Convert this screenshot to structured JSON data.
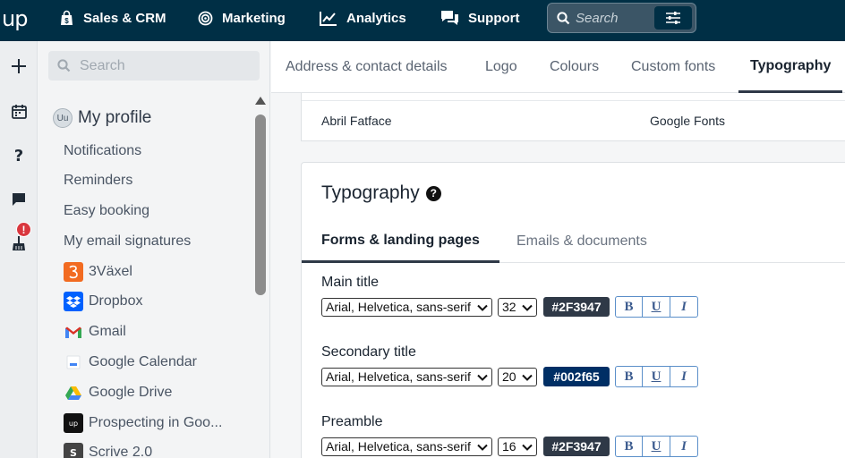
{
  "topnav": {
    "logo": "up",
    "items": [
      {
        "label": "Sales & CRM",
        "icon": "sales-icon"
      },
      {
        "label": "Marketing",
        "icon": "marketing-icon"
      },
      {
        "label": "Analytics",
        "icon": "analytics-icon"
      },
      {
        "label": "Support",
        "icon": "support-icon"
      }
    ],
    "search_placeholder": "Search"
  },
  "rail": {
    "notification_badge": "!"
  },
  "sidebar": {
    "search_placeholder": "Search",
    "profile": {
      "avatar_initials": "Uu",
      "label": "My profile"
    },
    "items": [
      {
        "label": "Notifications"
      },
      {
        "label": "Reminders"
      },
      {
        "label": "Easy booking"
      },
      {
        "label": "My email signatures"
      },
      {
        "label": "3Växel",
        "icon": "3vaxel-icon",
        "color": "#f26b21"
      },
      {
        "label": "Dropbox",
        "icon": "dropbox-icon",
        "color": "#0061fe"
      },
      {
        "label": "Gmail",
        "icon": "gmail-icon",
        "color": "#d93025"
      },
      {
        "label": "Google Calendar",
        "icon": "google-calendar-icon",
        "color": "#4285f4"
      },
      {
        "label": "Google Drive",
        "icon": "google-drive-icon",
        "color": "#34a853"
      },
      {
        "label": "Prospecting in Goo...",
        "icon": "prospecting-icon",
        "color": "#111111"
      },
      {
        "label": "Scrive 2.0",
        "icon": "scrive-icon",
        "color": "#444444"
      }
    ]
  },
  "tabs": [
    {
      "label": "Address & contact details"
    },
    {
      "label": "Logo"
    },
    {
      "label": "Colours"
    },
    {
      "label": "Custom fonts"
    },
    {
      "label": "Typography",
      "active": true
    }
  ],
  "custom_font": {
    "name": "Abril Fatface",
    "source": "Google Fonts"
  },
  "typography": {
    "title": "Typography",
    "help": "?",
    "subtabs": [
      {
        "label": "Forms & landing pages",
        "active": true
      },
      {
        "label": "Emails & documents"
      }
    ],
    "fields": [
      {
        "label": "Main title",
        "font": "Arial, Helvetica, sans-serif",
        "size": "32",
        "color": "#2F3947",
        "swatch": "#2f3947"
      },
      {
        "label": "Secondary title",
        "font": "Arial, Helvetica, sans-serif",
        "size": "20",
        "color": "#002f65",
        "swatch": "#002f65"
      },
      {
        "label": "Preamble",
        "font": "Arial, Helvetica, sans-serif",
        "size": "16",
        "color": "#2F3947",
        "swatch": "#2f3947"
      }
    ],
    "format_buttons": {
      "bold": "B",
      "underline": "U",
      "italic": "I"
    }
  }
}
